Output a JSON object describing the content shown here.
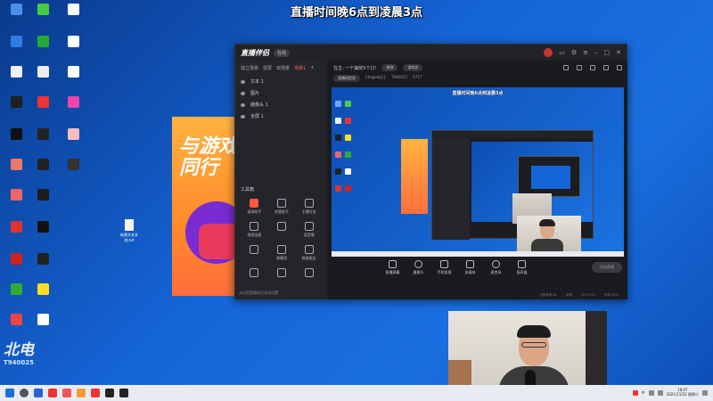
{
  "banner": "直播时间晚6点到凌晨3点",
  "desktop": {
    "file_label": "新建文本文档.txt"
  },
  "poster": {
    "text_line1": "与游戏",
    "text_line2": "同行"
  },
  "app": {
    "logo": "直播伴侣",
    "badge": "在线",
    "tabs": [
      "独立场景",
      "竖屏",
      "双场景",
      "场景1"
    ],
    "layers": [
      "文本 1",
      "图片",
      "摄像头 1",
      "全屏 1"
    ],
    "toolbox_title": "工具箱",
    "tools": [
      "录屏助手",
      "房管助手",
      "主播任务",
      "视频连麦",
      "",
      "语音播",
      "",
      "弹幕墙",
      "数据报告",
      "",
      "",
      ""
    ],
    "left_footer": "从抖音直播伴侣发送设置",
    "live_title": "在主: 一个抽奖5个口!",
    "pill1": "修改",
    "pill2": "游戏名",
    "sub1": "直播间信息",
    "sub2": "Chogod出王",
    "sub3": "T940025",
    "sub4": "5717",
    "preview_banner": "直播时间晚6点到凌晨3点",
    "controls": [
      "直播屏幕",
      "摄像头",
      "手机投屏",
      "多媒体",
      "麦克风",
      "扬声器"
    ],
    "start_live": "开始直播",
    "status": [
      "当前帧率:60",
      "码率",
      "CPU:23%",
      "内存:40%"
    ]
  },
  "watermark": {
    "text": "北电",
    "id": "T940025"
  },
  "taskbar": {
    "time": "18:07",
    "date": "2021/11/22 星期二",
    "lang": "中"
  },
  "colors": {
    "desktop_blue": "#1565d8",
    "app_bg": "#1c1d21",
    "accent": "#ff5a3c"
  }
}
